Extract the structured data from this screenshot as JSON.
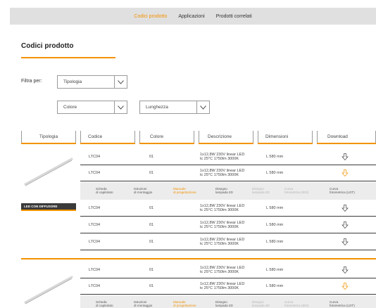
{
  "nav": {
    "items": [
      {
        "label": "Codici prodotto",
        "active": true
      },
      {
        "label": "Applicazioni",
        "active": false
      },
      {
        "label": "Prodotti correlati",
        "active": false
      }
    ]
  },
  "section": {
    "title": "Codici prodotto"
  },
  "filters": {
    "label": "Filtra per:",
    "tipologia": "Tipologia",
    "colore": "Colore",
    "lunghezza": "Lunghezza"
  },
  "table": {
    "headers": [
      "Tipologia",
      "Codice",
      "Colore",
      "Descrizione",
      "Dimensioni",
      "Download"
    ],
    "groups": [
      {
        "badge": "LED CON DIFFUSORE",
        "rows": [
          {
            "codice": "LTC04",
            "colore": "01",
            "desc1": "1x12,8W 230V linear LED",
            "desc2": "tc 25°C 1750lm 3000K",
            "dim": "L 580 mm",
            "download_active": false
          },
          {
            "codice": "LTC04",
            "colore": "01",
            "desc1": "1x12,8W 230V linear LED",
            "desc2": "tc 25°C 1750lm 3000K",
            "dim": "L 580 mm",
            "download_active": true
          }
        ],
        "docs": [
          {
            "l1": "Scheda",
            "l2": "di capitolato",
            "state": "normal"
          },
          {
            "l1": "Istruzioni",
            "l2": "di montaggio",
            "state": "normal"
          },
          {
            "l1": "Manuale",
            "l2": "di progettazione",
            "state": "orange"
          },
          {
            "l1": "Disegno",
            "l2": "lampada 2D",
            "state": "normal"
          },
          {
            "l1": "Disegno",
            "l2": "lampada 3D",
            "state": "grey"
          },
          {
            "l1": "Curva",
            "l2": "fotometrica (IES)",
            "state": "grey"
          },
          {
            "l1": "Curva",
            "l2": "fotometrica (LDT)",
            "state": "normal"
          }
        ],
        "rows_after": [
          {
            "codice": "LTC04",
            "colore": "01",
            "desc1": "1x12,8W 230V linear LED",
            "desc2": "tc 25°C 1750lm 3000K",
            "dim": "L 580 mm",
            "download_active": false
          },
          {
            "codice": "LTC04",
            "colore": "01",
            "desc1": "1x12,8W 230V linear LED",
            "desc2": "tc 25°C 1750lm 3000K",
            "dim": "L 580 mm",
            "download_active": false
          },
          {
            "codice": "LTC04",
            "colore": "01",
            "desc1": "1x12,8W 230V linear LED",
            "desc2": "tc 25°C 1750lm 3000K",
            "dim": "L 580 mm",
            "download_active": false
          }
        ]
      },
      {
        "rows": [
          {
            "codice": "LTC04",
            "colore": "01",
            "desc1": "1x12,8W 230V linear LED",
            "desc2": "tc 25°C 1750lm 3000K",
            "dim": "L 580 mm",
            "download_active": false
          },
          {
            "codice": "LTC04",
            "colore": "01",
            "desc1": "1x12,8W 230V linear LED",
            "desc2": "tc 25°C 1750lm 3000K",
            "dim": "L 580 mm",
            "download_active": true
          }
        ],
        "docs": [
          {
            "l1": "Scheda",
            "l2": "di capitolato",
            "state": "normal"
          },
          {
            "l1": "Istruzioni",
            "l2": "di montaggio",
            "state": "normal"
          },
          {
            "l1": "Manuale",
            "l2": "di progettazione",
            "state": "orange"
          },
          {
            "l1": "Disegno",
            "l2": "lampada 2D",
            "state": "normal"
          },
          {
            "l1": "Disegno",
            "l2": "lampada 3D",
            "state": "grey"
          },
          {
            "l1": "Curva",
            "l2": "fotometrica (IES)",
            "state": "grey"
          },
          {
            "l1": "Curva",
            "l2": "fotometrica (LDT)",
            "state": "normal"
          }
        ]
      }
    ]
  },
  "colors": {
    "accent": "#f39200",
    "dark": "#3a3a3a",
    "nav_bg": "#e0e0e0"
  },
  "icons": {
    "download": "download-arrow-icon",
    "chevron": "chevron-down-icon"
  }
}
